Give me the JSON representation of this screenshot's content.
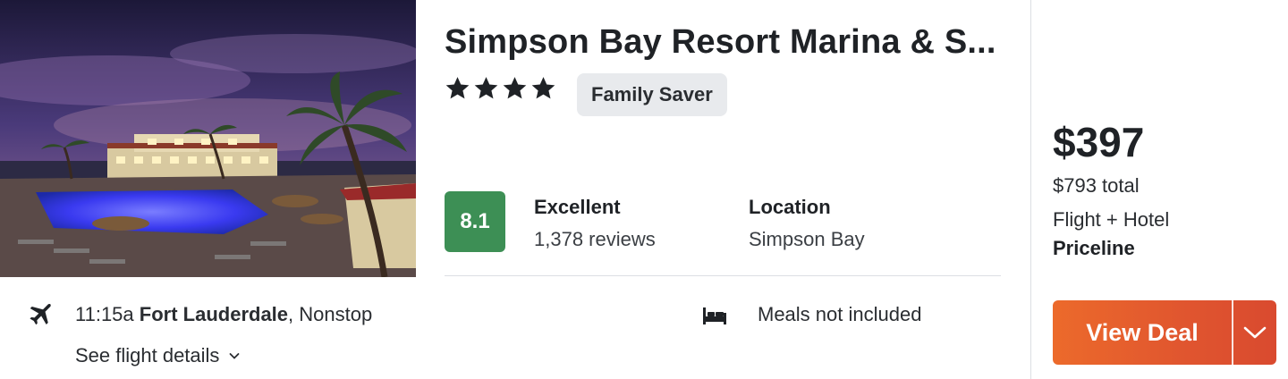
{
  "hotel": {
    "name": "Simpson Bay Resort Marina & S...",
    "star_count": 4,
    "badge": "Family Saver",
    "score": "8.1",
    "rating_label": "Excellent",
    "review_count": "1,378 reviews",
    "location_label": "Location",
    "location_value": "Simpson Bay",
    "image_description_icon": "hotel-pool-night-photo"
  },
  "flight": {
    "time": "11:15a",
    "origin": "Fort Lauderdale",
    "stops": ", Nonstop",
    "details_link": "See flight details",
    "icon": "airplane-icon"
  },
  "amenities": {
    "meals": "Meals not included",
    "icon": "bed-icon"
  },
  "pricing": {
    "price": "$397",
    "total": "$793 total",
    "package": "Flight + Hotel",
    "provider": "Priceline",
    "cta_label": "View Deal"
  },
  "colors": {
    "score_bg": "#3d8f55",
    "cta_start": "#ec6a2b",
    "cta_end": "#d94a2f",
    "badge_bg": "#e8eaed"
  }
}
